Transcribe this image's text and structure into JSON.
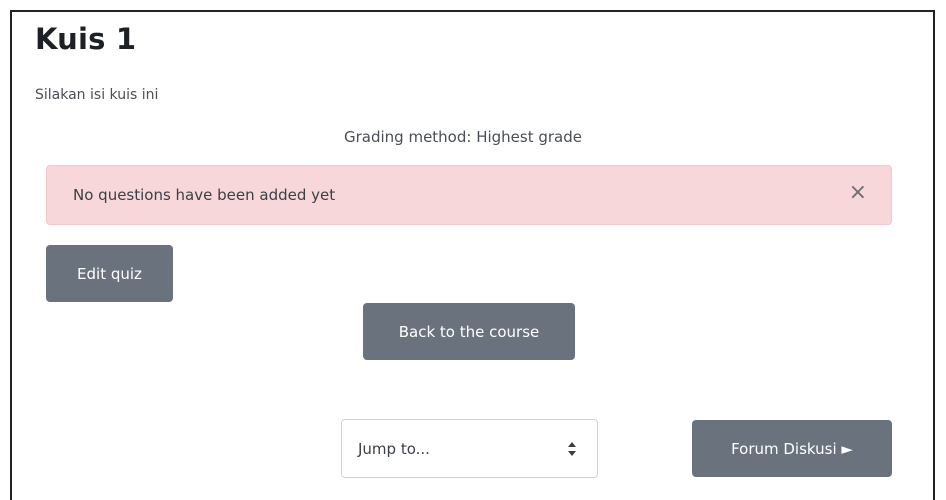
{
  "page": {
    "title": "Kuis 1",
    "intro": "Silakan isi kuis ini",
    "grading_method": "Grading method: Highest grade"
  },
  "alert": {
    "message": "No questions have been added yet",
    "close_glyph": "×",
    "background": "#f8d7da"
  },
  "buttons": {
    "edit_quiz": "Edit quiz",
    "back_to_course": "Back to the course",
    "forum_next": "Forum Diskusi ►",
    "color": "#6a737d"
  },
  "navigation": {
    "jump_to_selected": "Jump to...",
    "jump_icon": "select-updown-icon"
  }
}
